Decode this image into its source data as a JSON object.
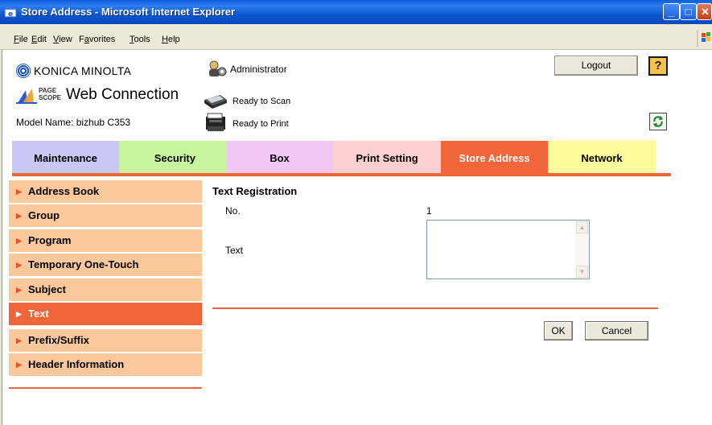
{
  "window": {
    "title": "Store Address - Microsoft Internet Explorer"
  },
  "menu": {
    "items": [
      {
        "label": "File",
        "hotkey": "F",
        "rest": "ile"
      },
      {
        "label": "Edit",
        "hotkey": "E",
        "rest": "dit"
      },
      {
        "label": "View",
        "hotkey": "V",
        "rest": "iew"
      },
      {
        "label": "Favorites",
        "hotkey": "a",
        "pre": "F",
        "rest": "vorites"
      },
      {
        "label": "Tools",
        "hotkey": "T",
        "rest": "ools"
      },
      {
        "label": "Help",
        "hotkey": "H",
        "rest": "elp"
      }
    ]
  },
  "header": {
    "brand": "KONICA MINOLTA",
    "pagescope_line1": "PAGE",
    "pagescope_line2": "SCOPE",
    "product": "Web Connection",
    "model": "Model Name: bizhub C353",
    "user": "Administrator",
    "scan_status": "Ready to Scan",
    "print_status": "Ready to Print",
    "logout_label": "Logout",
    "help_label": "?"
  },
  "tabs": [
    {
      "label": "Maintenance",
      "color": "#c8c8f4"
    },
    {
      "label": "Security",
      "color": "#c8f4a0"
    },
    {
      "label": "Box",
      "color": "#f4c8f4"
    },
    {
      "label": "Print Setting",
      "color": "#fcd0d0"
    },
    {
      "label": "Store Address",
      "color": "#f0653a",
      "active": true
    },
    {
      "label": "Network",
      "color": "#fcfc9c"
    }
  ],
  "sidebar": {
    "items": [
      {
        "label": "Address Book"
      },
      {
        "label": "Group"
      },
      {
        "label": "Program"
      },
      {
        "label": "Temporary One-Touch"
      },
      {
        "label": "Subject"
      },
      {
        "label": "Text",
        "active": true
      },
      {
        "label": "Prefix/Suffix"
      },
      {
        "label": "Header Information"
      }
    ]
  },
  "main": {
    "title": "Text Registration",
    "no_label": "No.",
    "no_value": "1",
    "text_label": "Text",
    "text_value": "",
    "ok_label": "OK",
    "cancel_label": "Cancel"
  },
  "colors": {
    "accent": "#f0653a",
    "sidebar": "#fbc89c",
    "titlebar": "#0b58d0"
  }
}
